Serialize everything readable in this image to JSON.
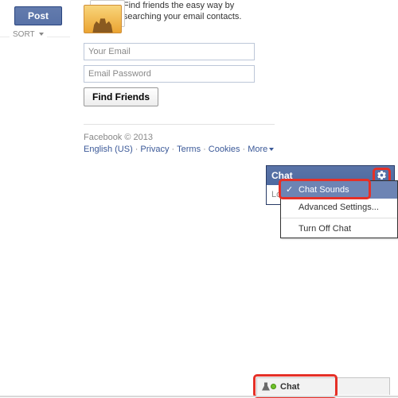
{
  "left": {
    "post": "Post",
    "sort": "SORT"
  },
  "friends": {
    "desc": "Find friends the easy way by searching your email contacts.",
    "email_ph": "Your Email",
    "pass_ph": "Email Password",
    "find_btn": "Find Friends"
  },
  "footer": {
    "copyright": "Facebook © 2013",
    "links": [
      "English (US)",
      "Privacy",
      "Terms",
      "Cookies",
      "More"
    ]
  },
  "chat": {
    "title": "Chat",
    "loading": "Loading",
    "menu": {
      "sounds": "Chat Sounds",
      "advanced": "Advanced Settings...",
      "turnoff": "Turn Off Chat"
    },
    "bar_label": "Chat"
  }
}
